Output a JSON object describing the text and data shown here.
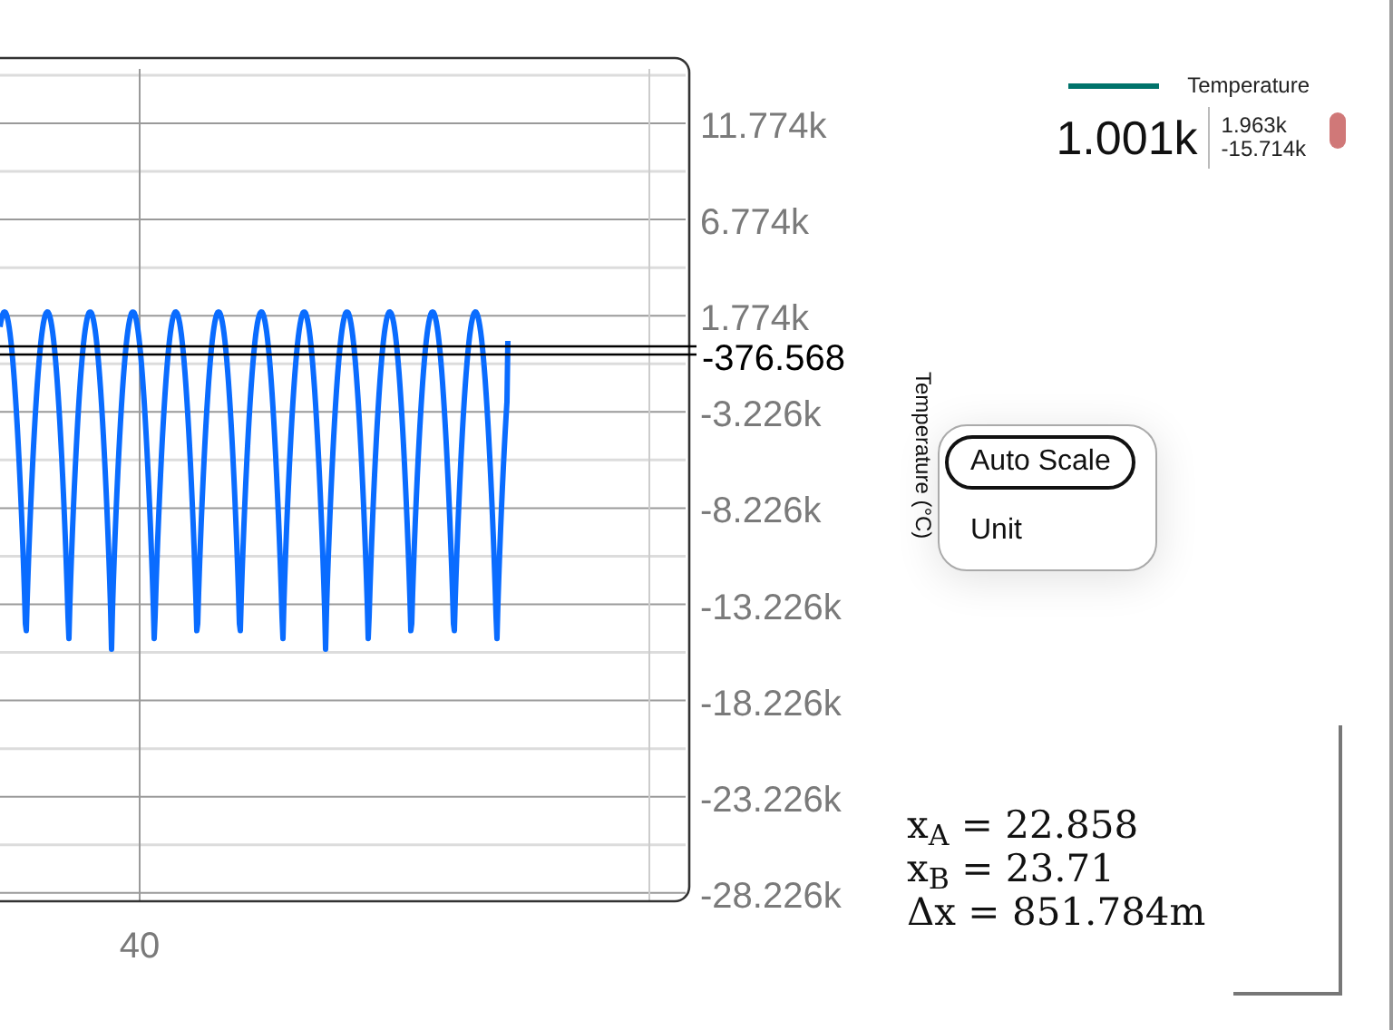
{
  "plot": {
    "y_ticks": [
      "11.774k",
      "6.774k",
      "1.774k",
      "-3.226k",
      "-8.226k",
      "-13.226k",
      "-18.226k",
      "-23.226k",
      "-28.226k"
    ],
    "x_ticks": [
      "40"
    ],
    "cursor_value": "-376.568"
  },
  "legend": [
    {
      "name": "Temperature",
      "color": "#00736b",
      "value": "1.001k",
      "max": "1.963k",
      "min": "-15.714k"
    }
  ],
  "axis_title": "Temperature (°C)",
  "context_menu": [
    {
      "label": "Auto Scale",
      "selected": true
    },
    {
      "label": "Unit",
      "selected": false
    }
  ],
  "readout": [
    "x$_{A}$ = 22.858",
    "x$_{B}$ = 23.71",
    "Δx = 851.784m"
  ]
}
